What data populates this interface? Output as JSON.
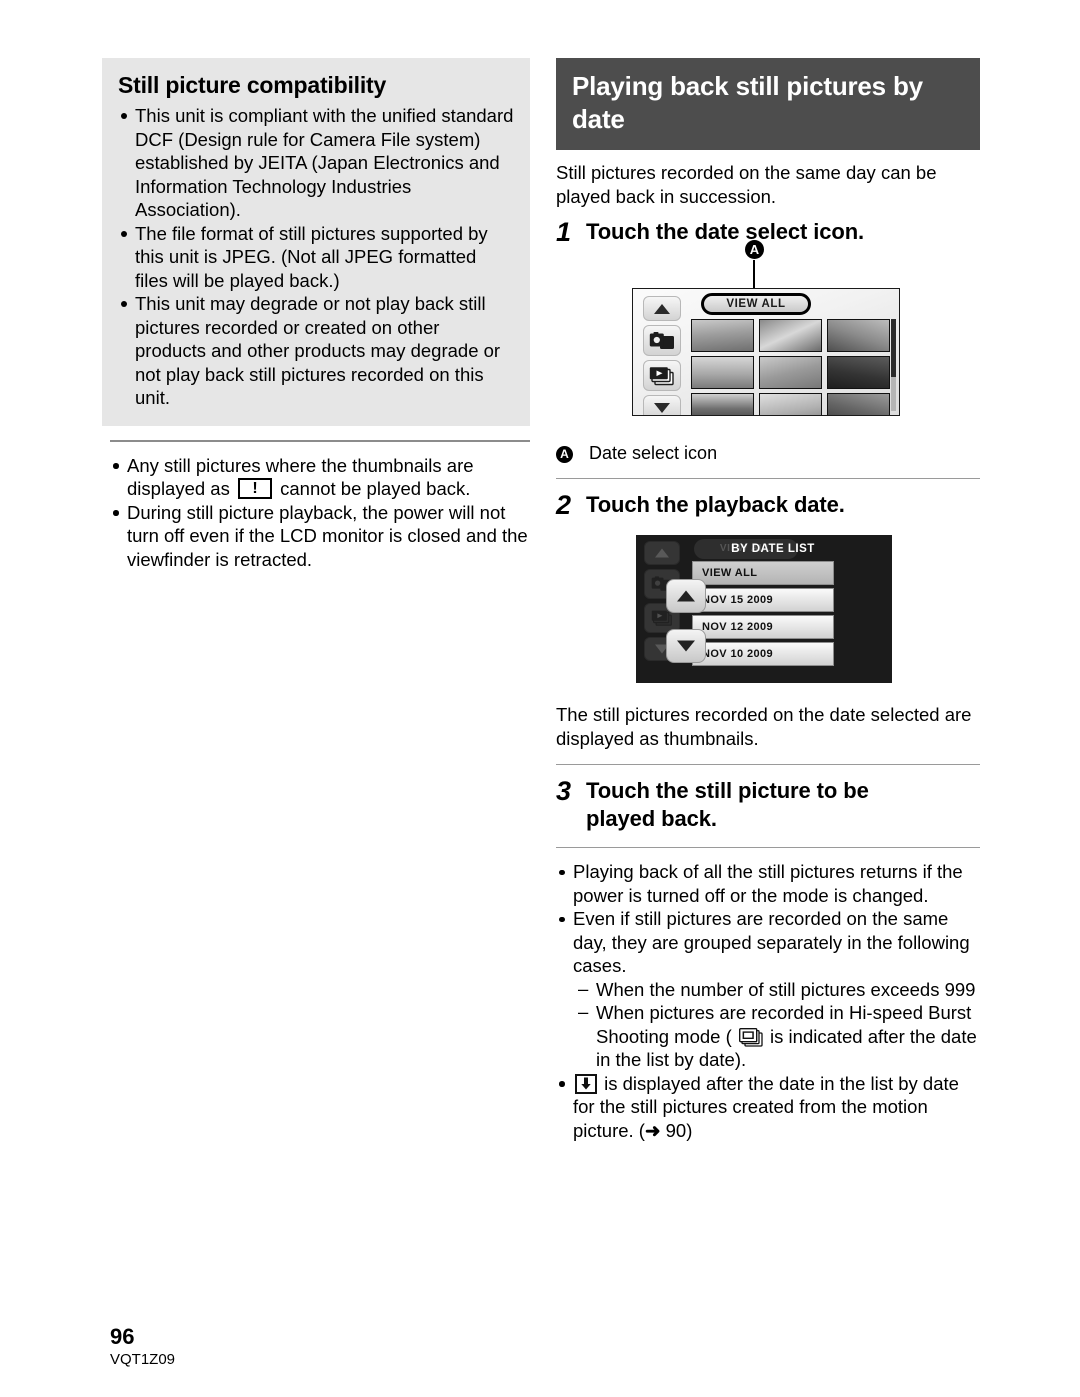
{
  "left_column": {
    "gray_box": {
      "heading": "Still picture compatibility",
      "bullets": [
        "This unit is compliant with the unified standard DCF (Design rule for Camera File system) established by JEITA (Japan Electronics and Information Technology Industries Association).",
        "The file format of still pictures supported by this unit is JPEG. (Not all JPEG formatted files will be played back.)",
        "This unit may degrade or not play back still pictures recorded or created on other products and other products may degrade or not play back still pictures recorded on this unit."
      ]
    },
    "notes": {
      "bullet1_part1": "Any still pictures where the thumbnails are displayed as",
      "bullet1_icon": "warning-thumbnail-icon",
      "bullet1_part2": "cannot be played back.",
      "bullet2": "During still picture playback, the power will not turn off even if the LCD monitor is closed and the viewfinder is retracted."
    }
  },
  "right_column": {
    "header": "Playing back still pictures by date",
    "lead": "Still pictures recorded on the same day can be played back in succession.",
    "steps": [
      {
        "number": "1",
        "text": "Touch the date select icon."
      },
      {
        "number": "2",
        "text": "Touch the playback date."
      },
      {
        "number": "3",
        "text": "Touch the still picture to be played back."
      }
    ],
    "screenshot1": {
      "callout_tag": "A",
      "view_all_label": "VIEW ALL",
      "side_icons": [
        "scroll-up-icon",
        "photo-mode-icon",
        "video-mode-icon",
        "scroll-down-icon"
      ]
    },
    "callout_caption": {
      "tag": "A",
      "label": "Date select icon"
    },
    "screenshot2": {
      "ghost_pill_label": "VIEW ALL",
      "title": "BY DATE LIST",
      "rows": [
        {
          "label": "VIEW ALL",
          "selected": true
        },
        {
          "label": "NOV 15 2009",
          "selected": false
        },
        {
          "label": "NOV 12 2009",
          "selected": false
        },
        {
          "label": "NOV 10 2009",
          "selected": false
        }
      ]
    },
    "after_screenshot2": "The still pictures recorded on the date selected are displayed as thumbnails.",
    "final_notes": {
      "bullet1": "Playing back of all the still pictures returns if the power is turned off or the mode is changed.",
      "bullet2": "Even if still pictures are recorded on the same day, they are grouped separately in the following cases.",
      "dash1": "When the number of still pictures exceeds 999",
      "dash2_part1": "When pictures are recorded in Hi-speed Burst Shooting mode (",
      "dash2_icon": "burst-shooting-icon",
      "dash2_part2": "is indicated after the date in the list by date).",
      "bullet3_icon": "motion-picture-capture-icon",
      "bullet3_part1": "is displayed after the date in the list by date for the still pictures created from the motion picture. (",
      "bullet3_arrow": "➜",
      "bullet3_page": "90",
      "bullet3_part2": ")"
    }
  },
  "footer": {
    "page_number": "96",
    "document_code": "VQT1Z09"
  },
  "colors": {
    "header_band": "#4d4d4d",
    "gray_box": "#e6e6e6",
    "rule": "#8c8c8c",
    "screen_dark": "#1b1b1b"
  }
}
